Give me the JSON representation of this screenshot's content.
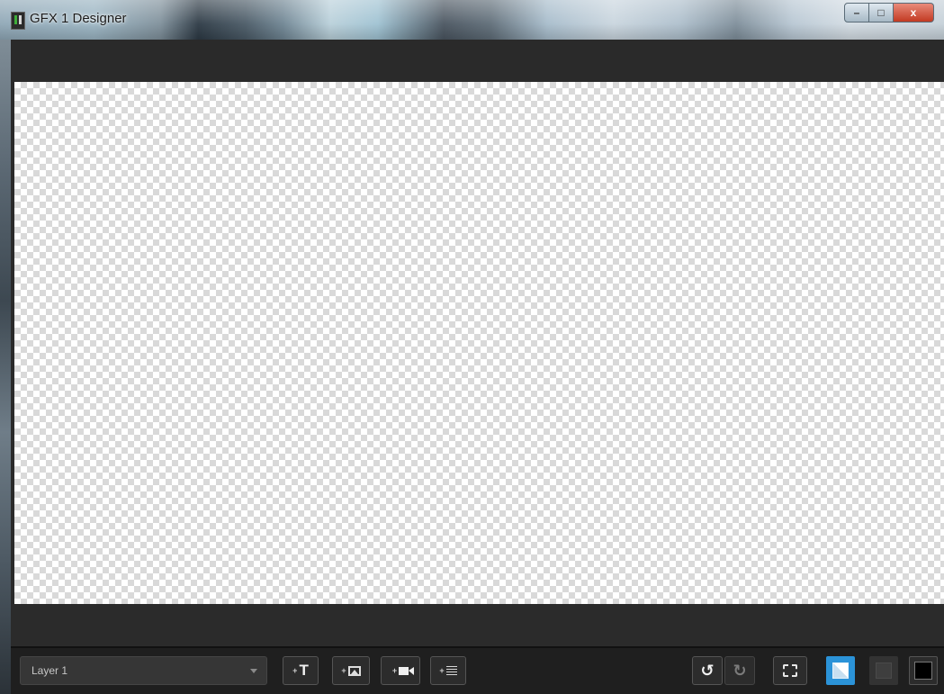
{
  "window": {
    "title": "GFX 1 Designer",
    "controls": {
      "minimize": "–",
      "maximize": "□",
      "close": "x"
    }
  },
  "toolbar": {
    "layer_select": {
      "value": "Layer 1"
    },
    "add_text": {
      "plus": "+",
      "glyph": "T"
    },
    "add_image": {
      "plus": "+"
    },
    "add_video": {
      "plus": "+"
    },
    "add_list": {
      "plus": "+"
    },
    "undo": {
      "glyph": "↺"
    },
    "redo": {
      "glyph": "↻"
    }
  },
  "icons": {
    "app": "gfx-app-icon",
    "text": "text-icon",
    "image": "image-icon",
    "video": "video-camera-icon",
    "list": "list-icon",
    "undo": "undo-icon",
    "redo": "redo-icon",
    "fit": "fit-to-screen-icon",
    "bg_transparent": "transparent-background-icon",
    "bg_dark": "dark-background-icon",
    "bg_black": "black-background-icon"
  },
  "colors": {
    "accent": "#2b93d8",
    "panel": "#2a2a2a",
    "toolbar": "#1f1f1f"
  }
}
